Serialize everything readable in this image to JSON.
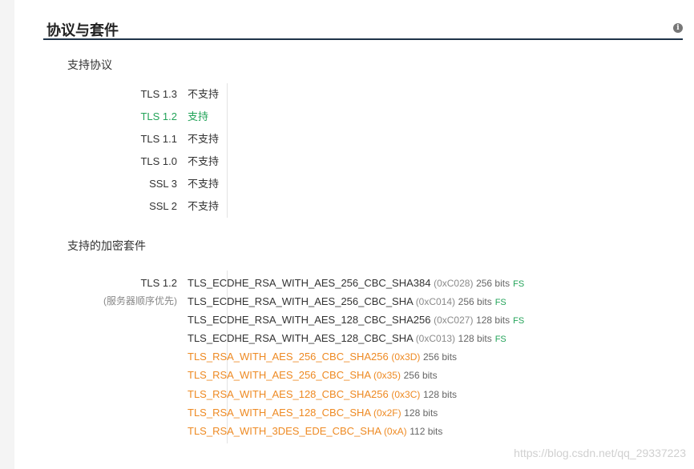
{
  "section": {
    "title": "协议与套件",
    "info_icon": "i"
  },
  "protocols": {
    "heading": "支持协议",
    "rows": [
      {
        "name": "TLS 1.3",
        "status": "不支持",
        "supported": false
      },
      {
        "name": "TLS 1.2",
        "status": "支持",
        "supported": true
      },
      {
        "name": "TLS 1.1",
        "status": "不支持",
        "supported": false
      },
      {
        "name": "TLS 1.0",
        "status": "不支持",
        "supported": false
      },
      {
        "name": "SSL 3",
        "status": "不支持",
        "supported": false
      },
      {
        "name": "SSL 2",
        "status": "不支持",
        "supported": false
      }
    ]
  },
  "ciphers": {
    "heading": "支持的加密套件",
    "protocol_label": "TLS 1.2",
    "protocol_note": "(服务器顺序优先)",
    "rows": [
      {
        "name": "TLS_ECDHE_RSA_WITH_AES_256_CBC_SHA384",
        "code": "(0xC028)",
        "bits": "256 bits",
        "fs": "FS",
        "weak": false
      },
      {
        "name": "TLS_ECDHE_RSA_WITH_AES_256_CBC_SHA",
        "code": "(0xC014)",
        "bits": "256 bits",
        "fs": "FS",
        "weak": false
      },
      {
        "name": "TLS_ECDHE_RSA_WITH_AES_128_CBC_SHA256",
        "code": "(0xC027)",
        "bits": "128 bits",
        "fs": "FS",
        "weak": false
      },
      {
        "name": "TLS_ECDHE_RSA_WITH_AES_128_CBC_SHA",
        "code": "(0xC013)",
        "bits": "128 bits",
        "fs": "FS",
        "weak": false
      },
      {
        "name": "TLS_RSA_WITH_AES_256_CBC_SHA256",
        "code": "(0x3D)",
        "bits": "256 bits",
        "fs": "",
        "weak": true
      },
      {
        "name": "TLS_RSA_WITH_AES_256_CBC_SHA",
        "code": "(0x35)",
        "bits": "256 bits",
        "fs": "",
        "weak": true
      },
      {
        "name": "TLS_RSA_WITH_AES_128_CBC_SHA256",
        "code": "(0x3C)",
        "bits": "128 bits",
        "fs": "",
        "weak": true
      },
      {
        "name": "TLS_RSA_WITH_AES_128_CBC_SHA",
        "code": "(0x2F)",
        "bits": "128 bits",
        "fs": "",
        "weak": true
      },
      {
        "name": "TLS_RSA_WITH_3DES_EDE_CBC_SHA",
        "code": "(0xA)",
        "bits": "112 bits",
        "fs": "",
        "weak": true
      }
    ]
  },
  "colors": {
    "supported": "#23a359",
    "weak": "#ee8a23",
    "rule": "#1f3349"
  },
  "watermark": "https://blog.csdn.net/qq_29337223"
}
